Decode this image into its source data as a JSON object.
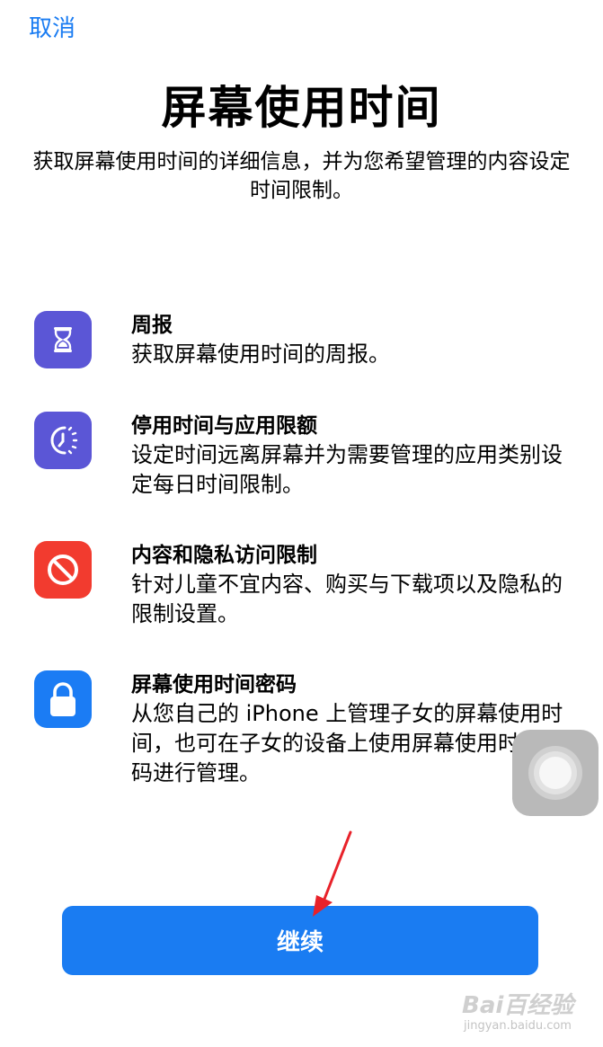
{
  "header": {
    "cancel_label": "取消",
    "title": "屏幕使用时间",
    "subtitle": "获取屏幕使用时间的详细信息，并为您希望管理的内容设定时间限制。"
  },
  "features": [
    {
      "icon": "hourglass-icon",
      "icon_color": "#5b56d6",
      "heading": "周报",
      "desc": "获取屏幕使用时间的周报。"
    },
    {
      "icon": "downtime-moon-icon",
      "icon_color": "#5b56d6",
      "heading": "停用时间与应用限额",
      "desc": "设定时间远离屏幕并为需要管理的应用类别设定每日时间限制。"
    },
    {
      "icon": "restriction-icon",
      "icon_color": "#f23b2f",
      "heading": "内容和隐私访问限制",
      "desc": "针对儿童不宜内容、购买与下载项以及隐私的限制设置。"
    },
    {
      "icon": "lock-icon",
      "icon_color": "#1b7cf4",
      "heading": "屏幕使用时间密码",
      "desc": "从您自己的 iPhone 上管理子女的屏幕使用时间，也可在子女的设备上使用屏幕使用时间密码进行管理。"
    }
  ],
  "footer": {
    "continue_label": "继续"
  },
  "watermark": {
    "text": "Bai百经验",
    "url": "jingyan.baidu.com"
  },
  "colors": {
    "accent": "#1a7cf2"
  }
}
